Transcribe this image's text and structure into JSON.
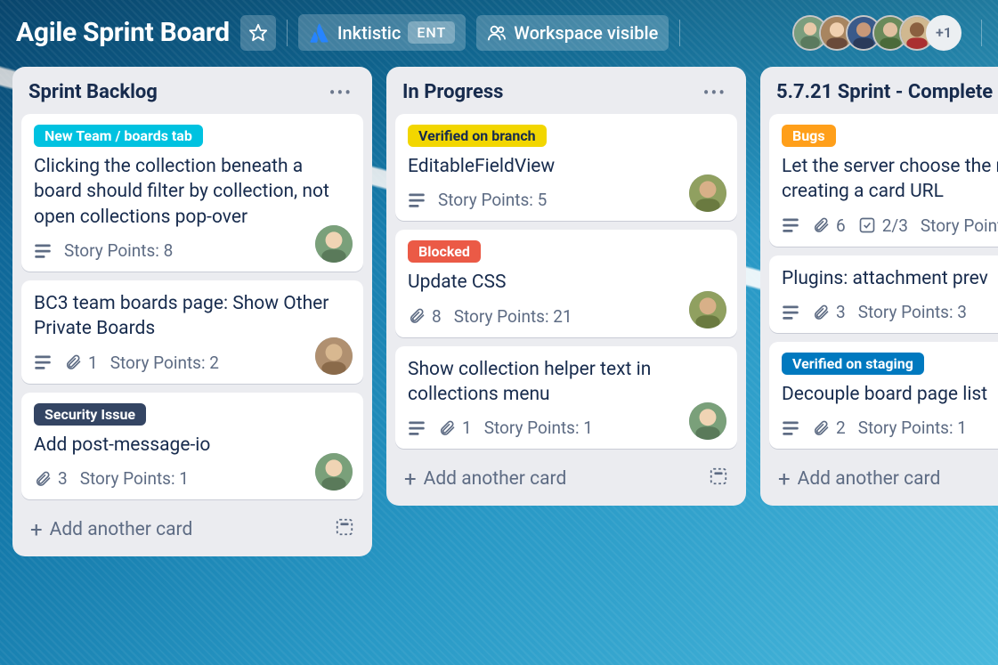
{
  "header": {
    "board_title": "Agile Sprint Board",
    "workspace_name": "Inktistic",
    "workspace_tier": "ENT",
    "visibility_label": "Workspace visible",
    "member_overflow": "+1"
  },
  "label_colors": {
    "teal": "#00c2e0",
    "yellow": "#f2d600",
    "red": "#eb5a46",
    "dark": "#344563",
    "orange": "#ff9f1a",
    "blue": "#0079bf"
  },
  "add_card_label": "Add another card",
  "story_points_prefix": "Story Points: ",
  "lists": [
    {
      "title": "Sprint Backlog",
      "show_menu": true,
      "cards": [
        {
          "labels": [
            {
              "text": "New Team / boards tab",
              "color": "teal"
            }
          ],
          "title": "Clicking the collection beneath a board should filter by collection, not open collections pop-over",
          "has_description": true,
          "attachments": null,
          "checklist": null,
          "story_points": "8",
          "member": "a"
        },
        {
          "labels": [],
          "title": "BC3 team boards page: Show Other Private Boards",
          "has_description": true,
          "attachments": "1",
          "checklist": null,
          "story_points": "2",
          "member": "b"
        },
        {
          "labels": [
            {
              "text": "Security Issue",
              "color": "dark"
            }
          ],
          "title": "Add post-message-io",
          "has_description": false,
          "attachments": "3",
          "checklist": null,
          "story_points": "1",
          "member": "a"
        }
      ]
    },
    {
      "title": "In Progress",
      "show_menu": true,
      "cards": [
        {
          "labels": [
            {
              "text": "Verified on branch",
              "color": "yellow"
            }
          ],
          "title": "EditableFieldView",
          "has_description": true,
          "attachments": null,
          "checklist": null,
          "story_points": "5",
          "member": "c"
        },
        {
          "labels": [
            {
              "text": "Blocked",
              "color": "red"
            }
          ],
          "title": "Update CSS",
          "has_description": false,
          "attachments": "8",
          "checklist": null,
          "story_points": "21",
          "member": "c"
        },
        {
          "labels": [],
          "title": "Show collection helper text in collections menu",
          "has_description": true,
          "attachments": "1",
          "checklist": null,
          "story_points": "1",
          "member": "a"
        }
      ]
    },
    {
      "title": "5.7.21 Sprint - Complete",
      "show_menu": false,
      "cards": [
        {
          "labels": [
            {
              "text": "Bugs",
              "color": "orange"
            }
          ],
          "title": "Let the server choose the name when creating a card URL",
          "has_description": true,
          "attachments": "6",
          "checklist": "2/3",
          "story_points": "",
          "member": null
        },
        {
          "labels": [],
          "title": "Plugins: attachment prev",
          "has_description": true,
          "attachments": "3",
          "checklist": null,
          "story_points": "3",
          "member": null
        },
        {
          "labels": [
            {
              "text": "Verified on staging",
              "color": "blue"
            }
          ],
          "title": "Decouple board page list",
          "has_description": true,
          "attachments": "2",
          "checklist": null,
          "story_points": "1",
          "member": null
        }
      ]
    }
  ]
}
